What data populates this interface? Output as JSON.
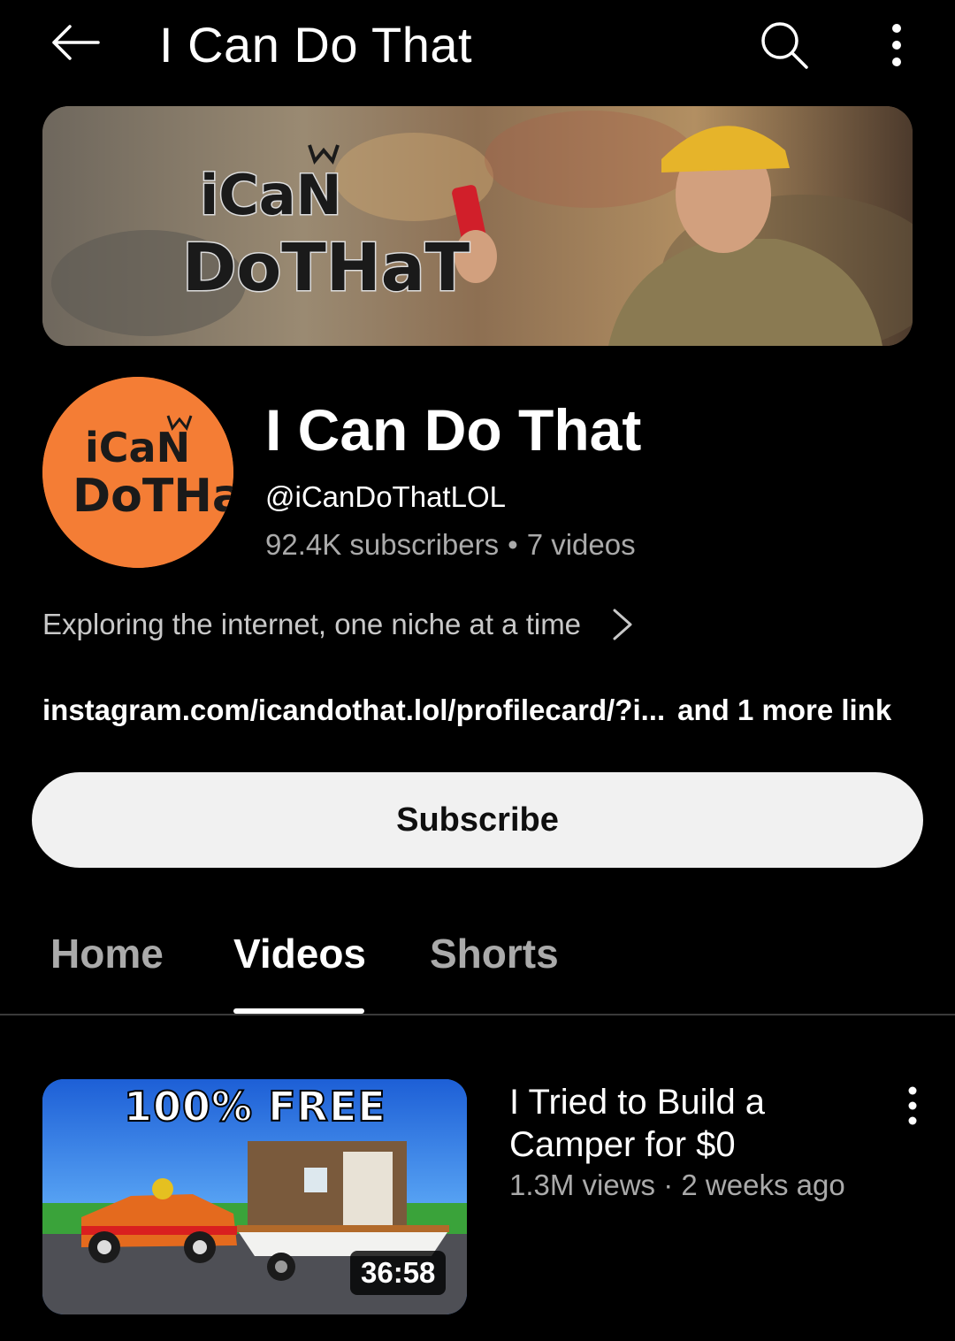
{
  "topbar": {
    "title": "I Can Do That",
    "back_icon": "arrow-left-icon",
    "search_icon": "search-icon",
    "more_icon": "more-vertical-icon"
  },
  "banner": {
    "logo_line1": "iCaN",
    "logo_line2": "DoTHaT"
  },
  "channel": {
    "avatar_line1": "iCaN",
    "avatar_line2": "DoTHaT",
    "name": "I Can Do That",
    "handle": "@iCanDoThatLOL",
    "subscribers": "92.4K subscribers",
    "separator": "•",
    "videos": "7 videos",
    "description": "Exploring the internet, one niche at a time",
    "link": "instagram.com/icandothat.lol/profilecard/?i...",
    "more_links": "and 1 more link",
    "subscribe_label": "Subscribe"
  },
  "tabs": [
    {
      "label": "Home",
      "active": false
    },
    {
      "label": "Videos",
      "active": true
    },
    {
      "label": "Shorts",
      "active": false
    }
  ],
  "videos": [
    {
      "thumb_text": "100% FREE",
      "duration": "36:58",
      "title": "I Tried to Build a Camper for $0",
      "views": "1.3M views",
      "separator": "·",
      "age": "2 weeks ago"
    }
  ],
  "colors": {
    "background": "#000000",
    "avatar": "#f47d35",
    "subscribe_bg": "#f1f1f1",
    "secondary_text": "#aaaaaa"
  }
}
